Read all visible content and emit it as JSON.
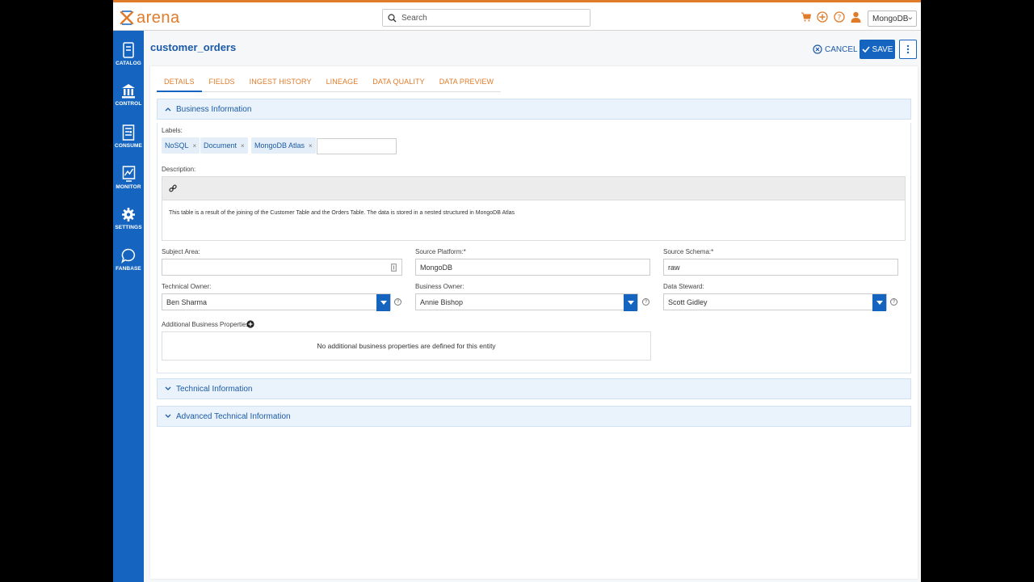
{
  "app": {
    "logo_text": "arena",
    "search_placeholder": "Search",
    "tenant": "MongoDB"
  },
  "sidebar": {
    "items": [
      {
        "label": "CATALOG",
        "icon": "catalog-icon"
      },
      {
        "label": "CONTROL",
        "icon": "bank-icon"
      },
      {
        "label": "CONSUME",
        "icon": "document-icon"
      },
      {
        "label": "MONITOR",
        "icon": "chart-icon"
      },
      {
        "label": "SETTINGS",
        "icon": "gear-icon"
      },
      {
        "label": "FANBASE",
        "icon": "chat-icon"
      }
    ]
  },
  "header": {
    "title": "customer_orders",
    "cancel_label": "CANCEL",
    "save_label": "SAVE"
  },
  "tabs": [
    "DETAILS",
    "FIELDS",
    "INGEST HISTORY",
    "LINEAGE",
    "DATA QUALITY",
    "DATA PREVIEW"
  ],
  "sections": {
    "business": "Business Information",
    "technical": "Technical Information",
    "advanced": "Advanced Technical Information"
  },
  "form": {
    "labels_label": "Labels:",
    "labels": [
      "NoSQL",
      "Document",
      "MongoDB Atlas"
    ],
    "description_label": "Description:",
    "description": "This table is a result of the joining of the Customer Table and the Orders Table.  The data is stored in a nested structured in MongoDB Atlas",
    "subject_area_label": "Subject Area:",
    "subject_area": "",
    "source_platform_label": "Source Platform:*",
    "source_platform": "MongoDB",
    "source_schema_label": "Source Schema:*",
    "source_schema": "raw",
    "technical_owner_label": "Technical Owner:",
    "technical_owner": "Ben Sharma",
    "business_owner_label": "Business Owner:",
    "business_owner": "Annie Bishop",
    "data_steward_label": "Data Steward:",
    "data_steward": "Scott Gidley",
    "additional_props_label": "Additional Business Properties:",
    "additional_props_empty": "No additional business properties are defined for this entity"
  },
  "colors": {
    "accent": "#e07b2a",
    "primary": "#1565c0"
  }
}
